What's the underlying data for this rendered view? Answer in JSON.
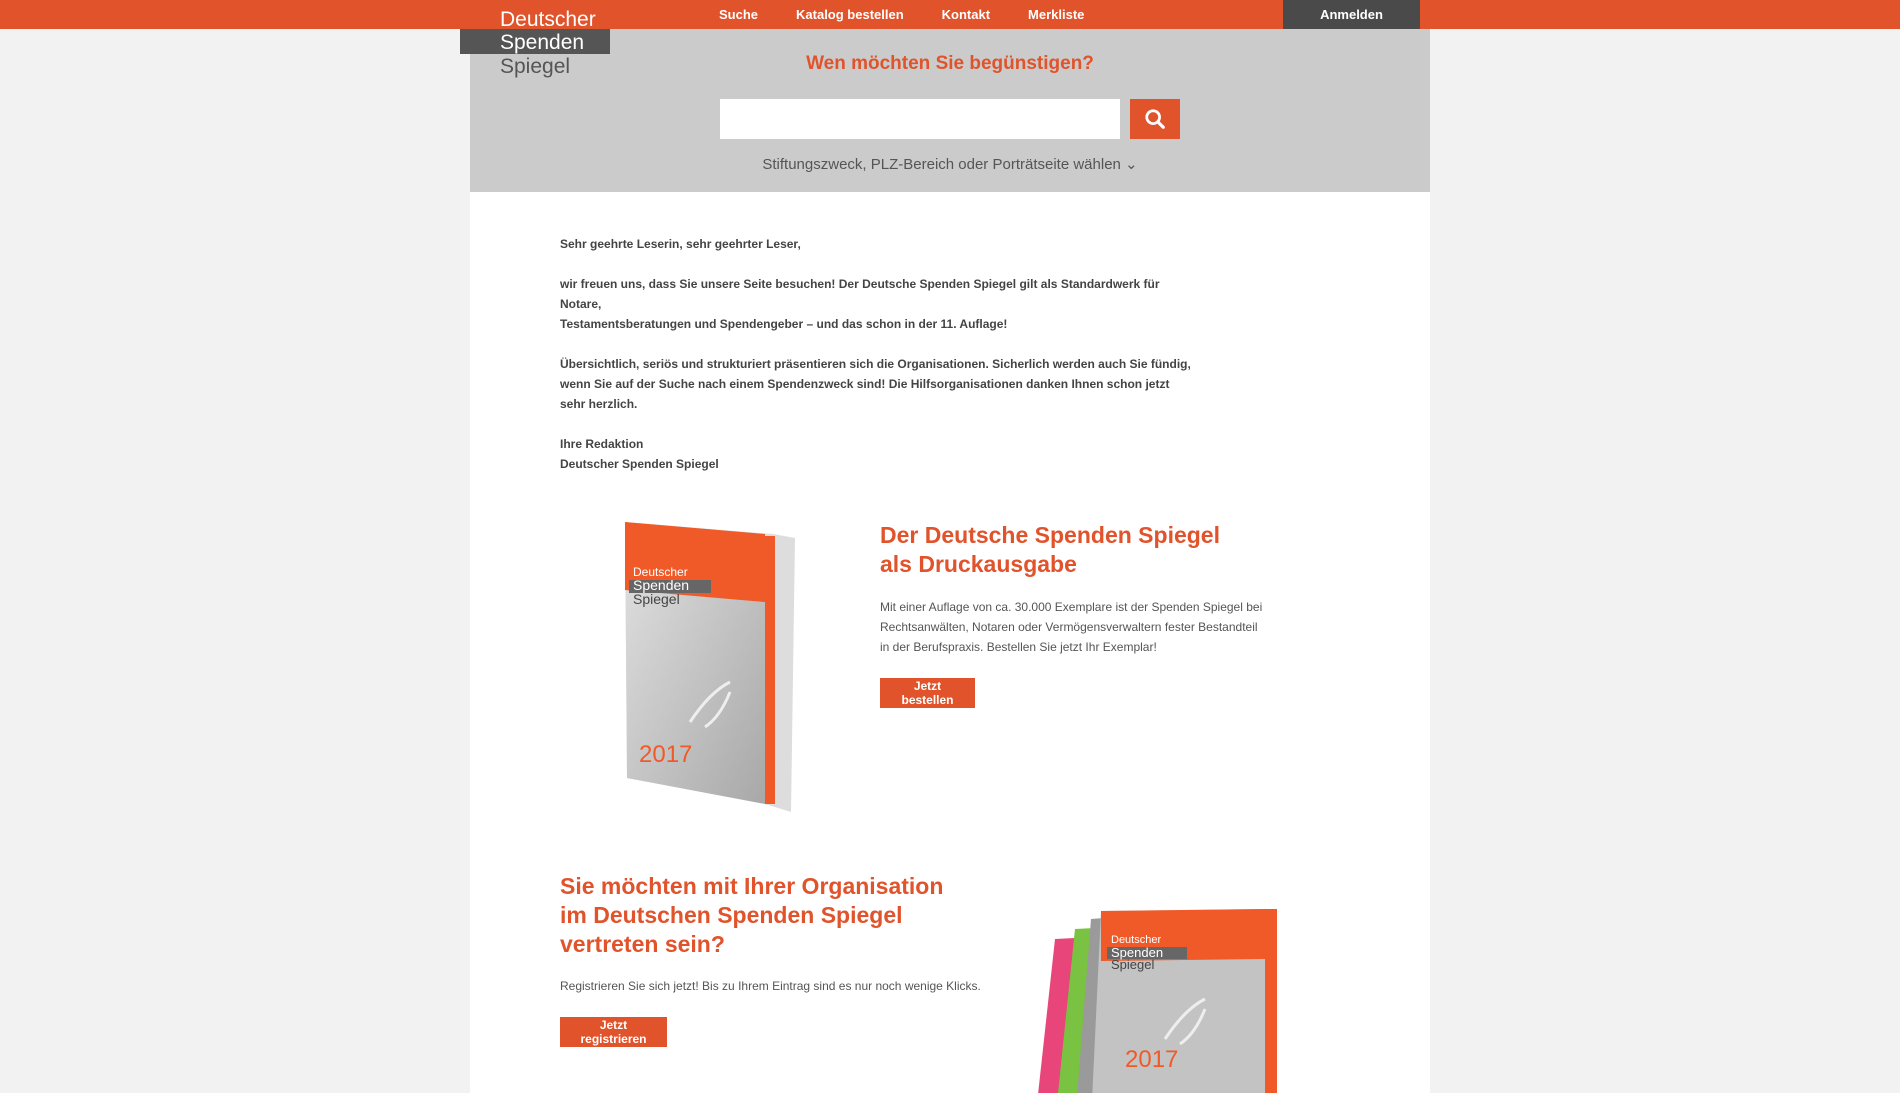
{
  "header": {
    "logo": [
      "Deutscher",
      "Spenden",
      "Spiegel"
    ],
    "nav": [
      "Suche",
      "Katalog bestellen",
      "Kontakt",
      "Merkliste"
    ],
    "login_label": "Anmelden"
  },
  "search": {
    "question": "Wen möchten Sie begünstigen?",
    "placeholder": "",
    "filter_link": "Stiftungszweck, PLZ-Bereich oder Porträtseite wählen ⌄"
  },
  "intro": {
    "greeting": "Sehr geehrte Leserin, sehr geehrter Leser,",
    "p1_line1": "wir freuen uns, dass Sie unsere Seite besuchen! Der Deutsche Spenden Spiegel gilt als Standardwerk für Notare,",
    "p1_line2": "Testamentsberatungen und Spendengeber – und das schon in der 11. Auflage!",
    "p2_line1": "Übersichtlich, seriös und strukturiert präsentieren sich die Organisationen. Sicherlich werden auch Sie fündig,",
    "p2_line2": "wenn Sie auf der Suche nach einem Spendenzweck sind! Die Hilfsorganisationen danken Ihnen schon jetzt",
    "p2_line3": "sehr herzlich.",
    "sign1": "Ihre Redaktion",
    "sign2": "Deutscher Spenden Spiegel"
  },
  "print": {
    "title1": "Der Deutsche Spenden Spiegel",
    "title2": "als Druckausgabe",
    "text1": "Mit einer Auflage von ca. 30.000 Exemplare ist der Spenden Spiegel bei",
    "text2": "Rechtsanwälten, Notaren oder Vermögensverwaltern fester Bestandteil",
    "text3": "in der Berufspraxis. Bestellen Sie jetzt Ihr Exemplar!",
    "button": "Jetzt bestellen",
    "book_year": "2017"
  },
  "register": {
    "title1": "Sie möchten mit Ihrer Organisation",
    "title2": "im Deutschen Spenden Spiegel",
    "title3": "vertreten sein?",
    "text": "Registrieren Sie sich jetzt! Bis zu Ihrem Eintrag sind es nur noch wenige Klicks.",
    "button": "Jetzt registrieren",
    "book_year": "2017"
  },
  "colors": {
    "accent": "#e0532b",
    "dark": "#4a4a4a",
    "search_bg": "#cbcbcb"
  },
  "icons": {
    "search": "search-icon"
  }
}
